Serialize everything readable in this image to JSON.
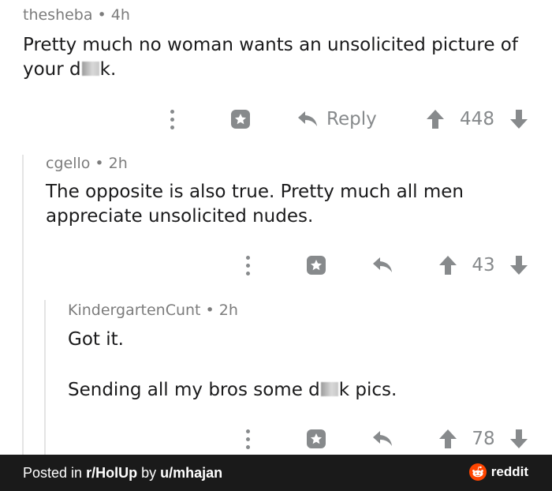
{
  "comments": [
    {
      "username": "thesheba",
      "age": "4h",
      "line1": "Pretty much no woman wants an unsolicited picture of",
      "line2_pre": "your d",
      "line2_post": "k.",
      "reply_label": "Reply",
      "score": "448"
    },
    {
      "username": "cgello",
      "age": "2h",
      "line1": "The opposite is also true. Pretty much all men",
      "line2": "appreciate unsolicited nudes.",
      "score": "43"
    },
    {
      "username": "KindergartenCunt",
      "age": "2h",
      "line1": "Got it.",
      "line3_pre": "Sending all my bros some d",
      "line3_post": "k pics.",
      "score": "78"
    }
  ],
  "separator": "•",
  "footer": {
    "posted_in": "Posted in",
    "subreddit": "r/HolUp",
    "by": "by",
    "user": "u/mhajan",
    "brand": "reddit"
  },
  "colors": {
    "text": "#1a1a1b",
    "meta": "#7c7c7c",
    "icon": "#878a8c",
    "footer_bg": "#1a1a1a",
    "reddit_orange": "#ff4500"
  },
  "icons": [
    "more-vertical-icon",
    "award-icon",
    "reply-arrow-icon",
    "upvote-icon",
    "downvote-icon",
    "reddit-logo-icon"
  ]
}
